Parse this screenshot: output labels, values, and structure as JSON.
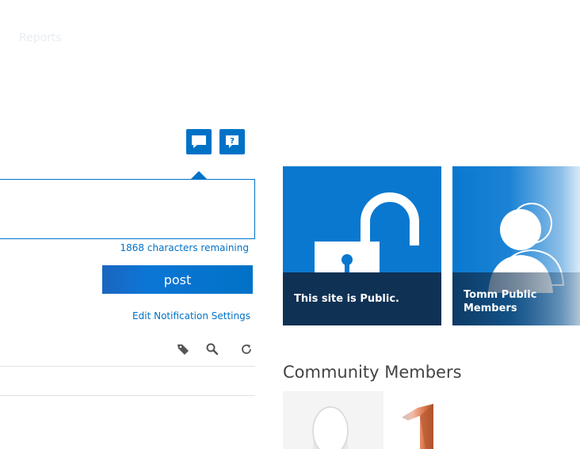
{
  "nav": {
    "reports_label": "Reports"
  },
  "newsfeed": {
    "chars_remaining": "1868 characters remaining",
    "post_label": "post",
    "edit_notifications": "Edit Notification Settings",
    "post_placeholder": ""
  },
  "tiles": [
    {
      "caption": "This site is Public."
    },
    {
      "caption_line1": "Tomm Public",
      "caption_line2": "Members"
    }
  ],
  "community": {
    "title": "Community Members"
  },
  "colors": {
    "accent": "#0072c6",
    "tile_bg": "#0a78cf",
    "caption_bg": "#0f3153"
  },
  "icons": [
    "speech-bubble-icon",
    "question-icon",
    "tag-icon",
    "search-icon",
    "refresh-icon",
    "padlock-open-icon",
    "people-icon"
  ]
}
